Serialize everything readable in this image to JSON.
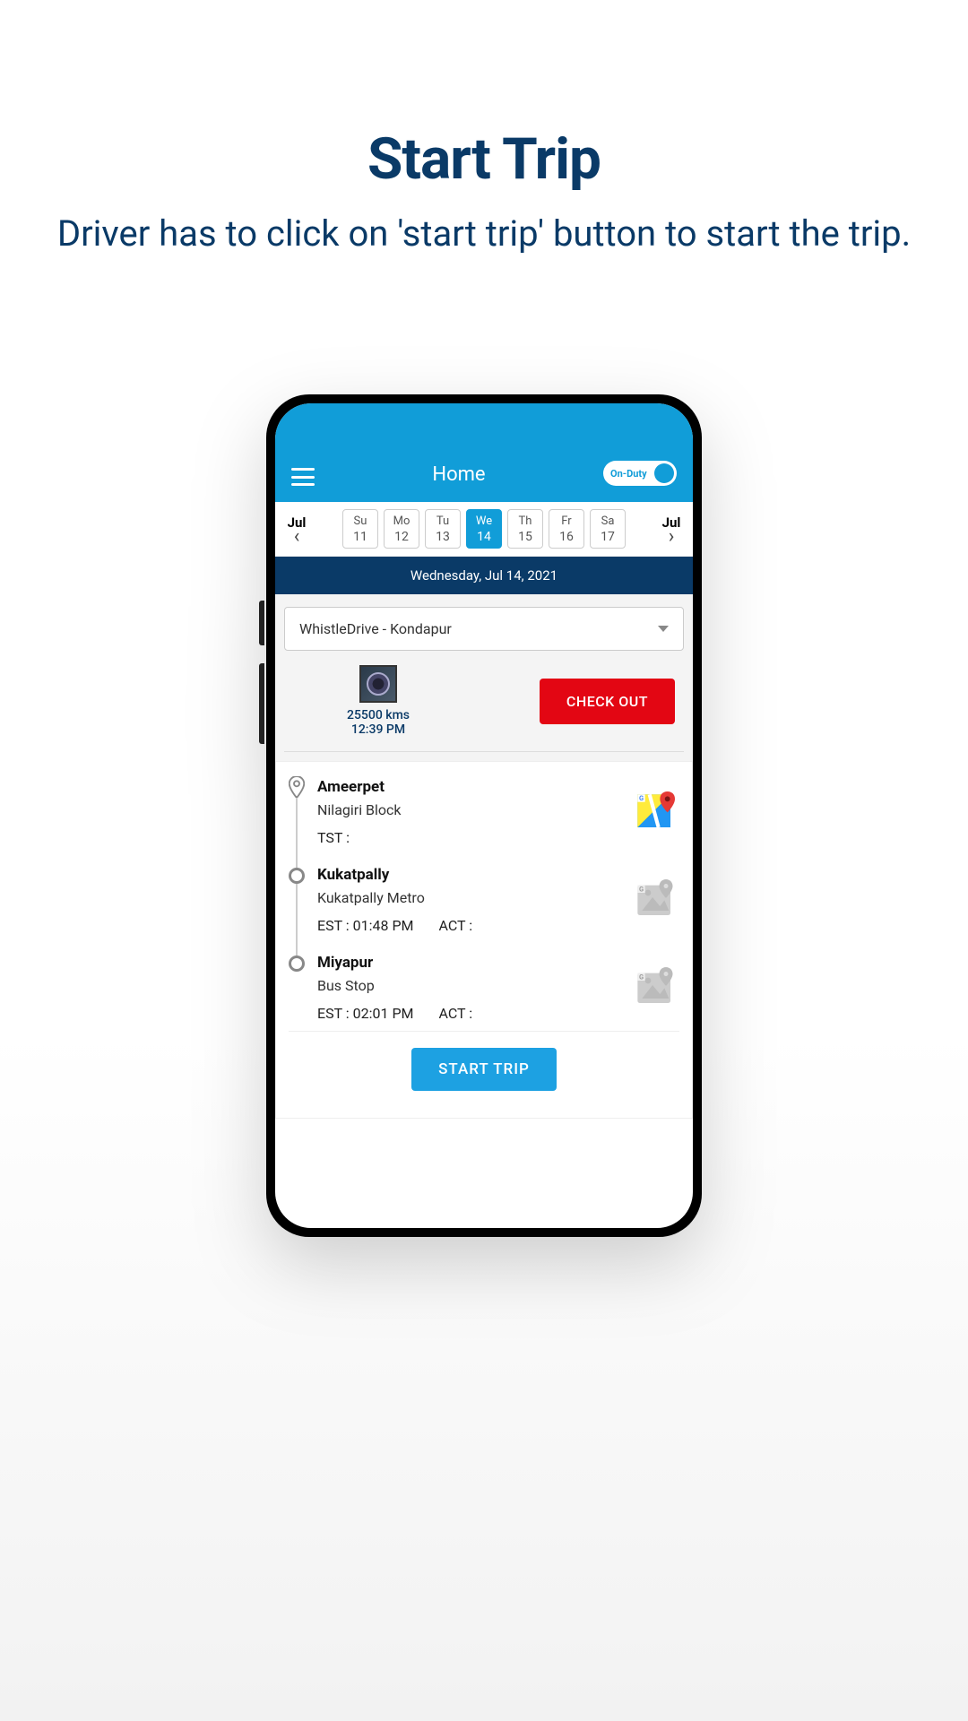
{
  "promo": {
    "title": "Start Trip",
    "subtitle": "Driver has to click on  'start trip' button to start the trip."
  },
  "header": {
    "title": "Home",
    "duty_label": "On-Duty"
  },
  "calendar": {
    "month_left": "Jul",
    "month_right": "Jul",
    "days": [
      {
        "dw": "Su",
        "dn": "11",
        "selected": false
      },
      {
        "dw": "Mo",
        "dn": "12",
        "selected": false
      },
      {
        "dw": "Tu",
        "dn": "13",
        "selected": false
      },
      {
        "dw": "We",
        "dn": "14",
        "selected": true
      },
      {
        "dw": "Th",
        "dn": "15",
        "selected": false
      },
      {
        "dw": "Fr",
        "dn": "16",
        "selected": false
      },
      {
        "dw": "Sa",
        "dn": "17",
        "selected": false
      }
    ],
    "banner": "Wednesday,  Jul 14, 2021"
  },
  "site_select": {
    "value": "WhistleDrive - Kondapur"
  },
  "odometer": {
    "kms": "25500 kms",
    "time": "12:39 PM"
  },
  "checkout_label": "CHECK OUT",
  "stops": [
    {
      "name": "Ameerpet",
      "sub": "Nilagiri Block",
      "tst": "TST :",
      "est": "",
      "act": "",
      "first": true,
      "map_active": true
    },
    {
      "name": "Kukatpally",
      "sub": "Kukatpally Metro",
      "tst": "",
      "est": "EST : 01:48 PM",
      "act": "ACT :",
      "first": false,
      "map_active": false
    },
    {
      "name": "Miyapur",
      "sub": "Bus Stop",
      "tst": "",
      "est": "EST : 02:01 PM",
      "act": "ACT :",
      "first": false,
      "map_active": false
    }
  ],
  "start_trip_label": "START TRIP"
}
